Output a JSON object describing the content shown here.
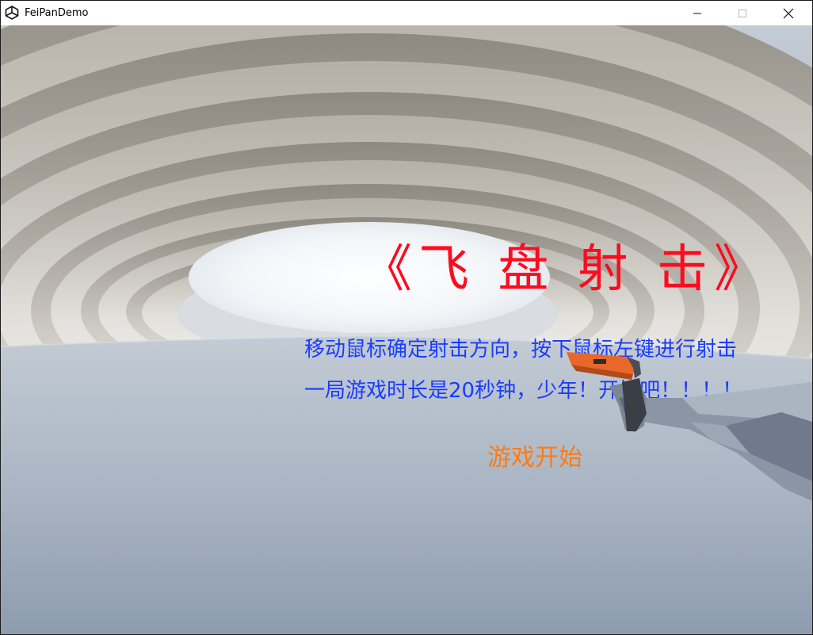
{
  "window": {
    "title": "FeiPanDemo",
    "app_icon": "unity-logo-icon",
    "controls": [
      "minimize-icon",
      "maximize-icon",
      "close-icon"
    ]
  },
  "game": {
    "title": "《飞 盘 射 击》",
    "instruction_line1": "移动鼠标确定射击方向，按下鼠标左键进行射击",
    "instruction_line2": "一局游戏时长是20秒钟，少年！开始吧！！！！",
    "start_button": "游戏开始"
  },
  "colors": {
    "title": "#ff0a1e",
    "instructions": "#1a3cff",
    "start_button": "#ff7a14",
    "gun_body": "#e8682a",
    "arm": "#8a96a6"
  }
}
